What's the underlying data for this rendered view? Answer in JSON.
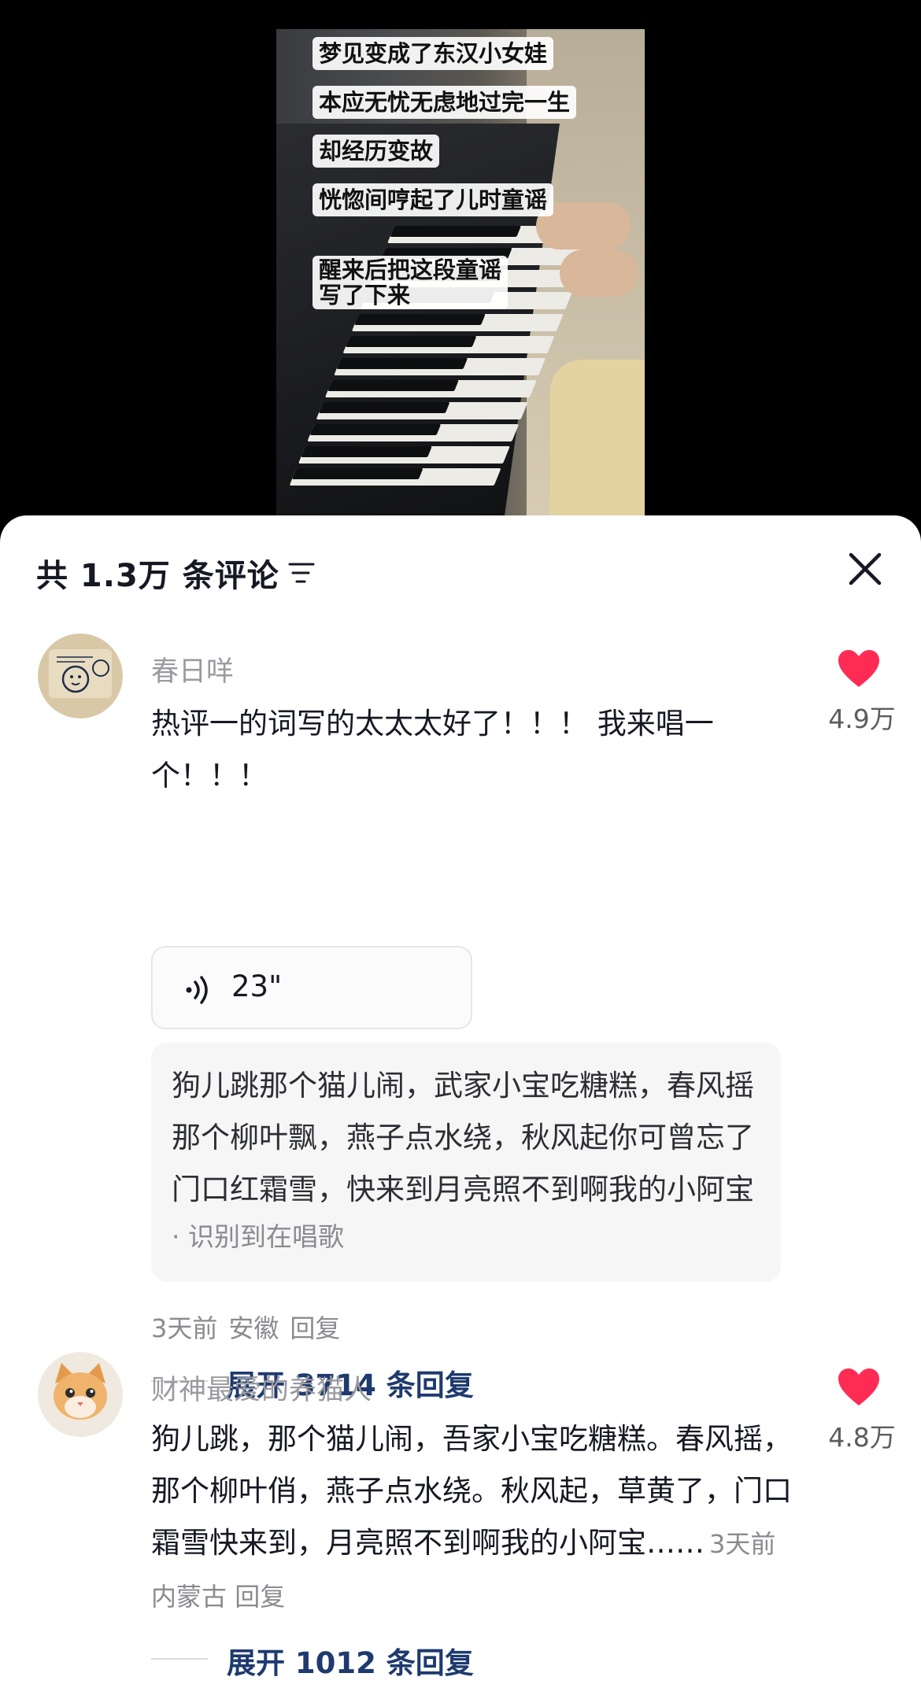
{
  "video": {
    "captions": [
      "梦见变成了东汉小女娃",
      "本应无忧无虑地过完一生",
      "却经历变故",
      "恍惚间哼起了儿时童谣",
      "醒来后把这段童谣\n写了下来"
    ]
  },
  "sheet": {
    "comment_count": "共 1.3万 条评论",
    "filter_icon": "filter-icon",
    "close_icon": "close-icon"
  },
  "comments": [
    {
      "username": "春日咩",
      "text": "热评一的词写的太太太好了！！！ 我来唱一个！！！",
      "likes": "4.9万",
      "voice_duration": "23\"",
      "lyrics": "狗儿跳那个猫儿闹，武家小宝吃糖糕，春风摇那个柳叶飘，燕子点水绕，秋风起你可曾忘了门口红霜雪，快来到月亮照不到啊我的小阿宝",
      "lyrics_tag": "· 识别到在唱歌",
      "time": "3天前",
      "location": "安徽",
      "reply": "回复",
      "expand": "展开 3714 条回复"
    },
    {
      "username": "财神最爱的养猫人",
      "text": "狗儿跳，那个猫儿闹，吾家小宝吃糖糕。春风摇，那个柳叶俏，燕子点水绕。秋风起，草黄了，门口霜雪快来到，月亮照不到啊我的小阿宝……",
      "likes": "4.8万",
      "time": "3天前",
      "location": "内蒙古",
      "reply": "回复",
      "expand": "展开 1012 条回复"
    }
  ],
  "colors": {
    "like_red": "#fe2c55",
    "expand_blue": "#1e3a6e",
    "muted": "#8a8a90"
  }
}
